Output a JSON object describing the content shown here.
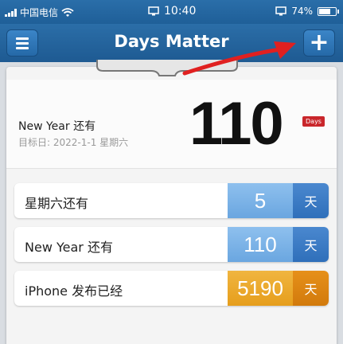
{
  "status": {
    "carrier": "中国电信",
    "time": "10:40",
    "battery": "74%",
    "battery_level": 0.74
  },
  "nav": {
    "title": "Days Matter",
    "menu_icon": "menu-icon",
    "add_icon": "plus-icon",
    "add_glyph": "+"
  },
  "hero": {
    "title": "New Year 还有",
    "target_date": "目标日: 2022-1-1 星期六",
    "days": "110",
    "badge": "Days"
  },
  "events": [
    {
      "label": "星期六还有",
      "value": "5",
      "unit": "天",
      "style": "blue"
    },
    {
      "label": "New Year 还有",
      "value": "110",
      "unit": "天",
      "style": "blue"
    },
    {
      "label": "iPhone 发布已经",
      "value": "5190",
      "unit": "天",
      "style": "orange"
    }
  ],
  "colors": {
    "navbar": "#1f5f98",
    "countdown": "#2f6fba",
    "elapsed": "#e69e1c",
    "badge": "#c9262b",
    "annotation_arrow": "#e02020"
  }
}
